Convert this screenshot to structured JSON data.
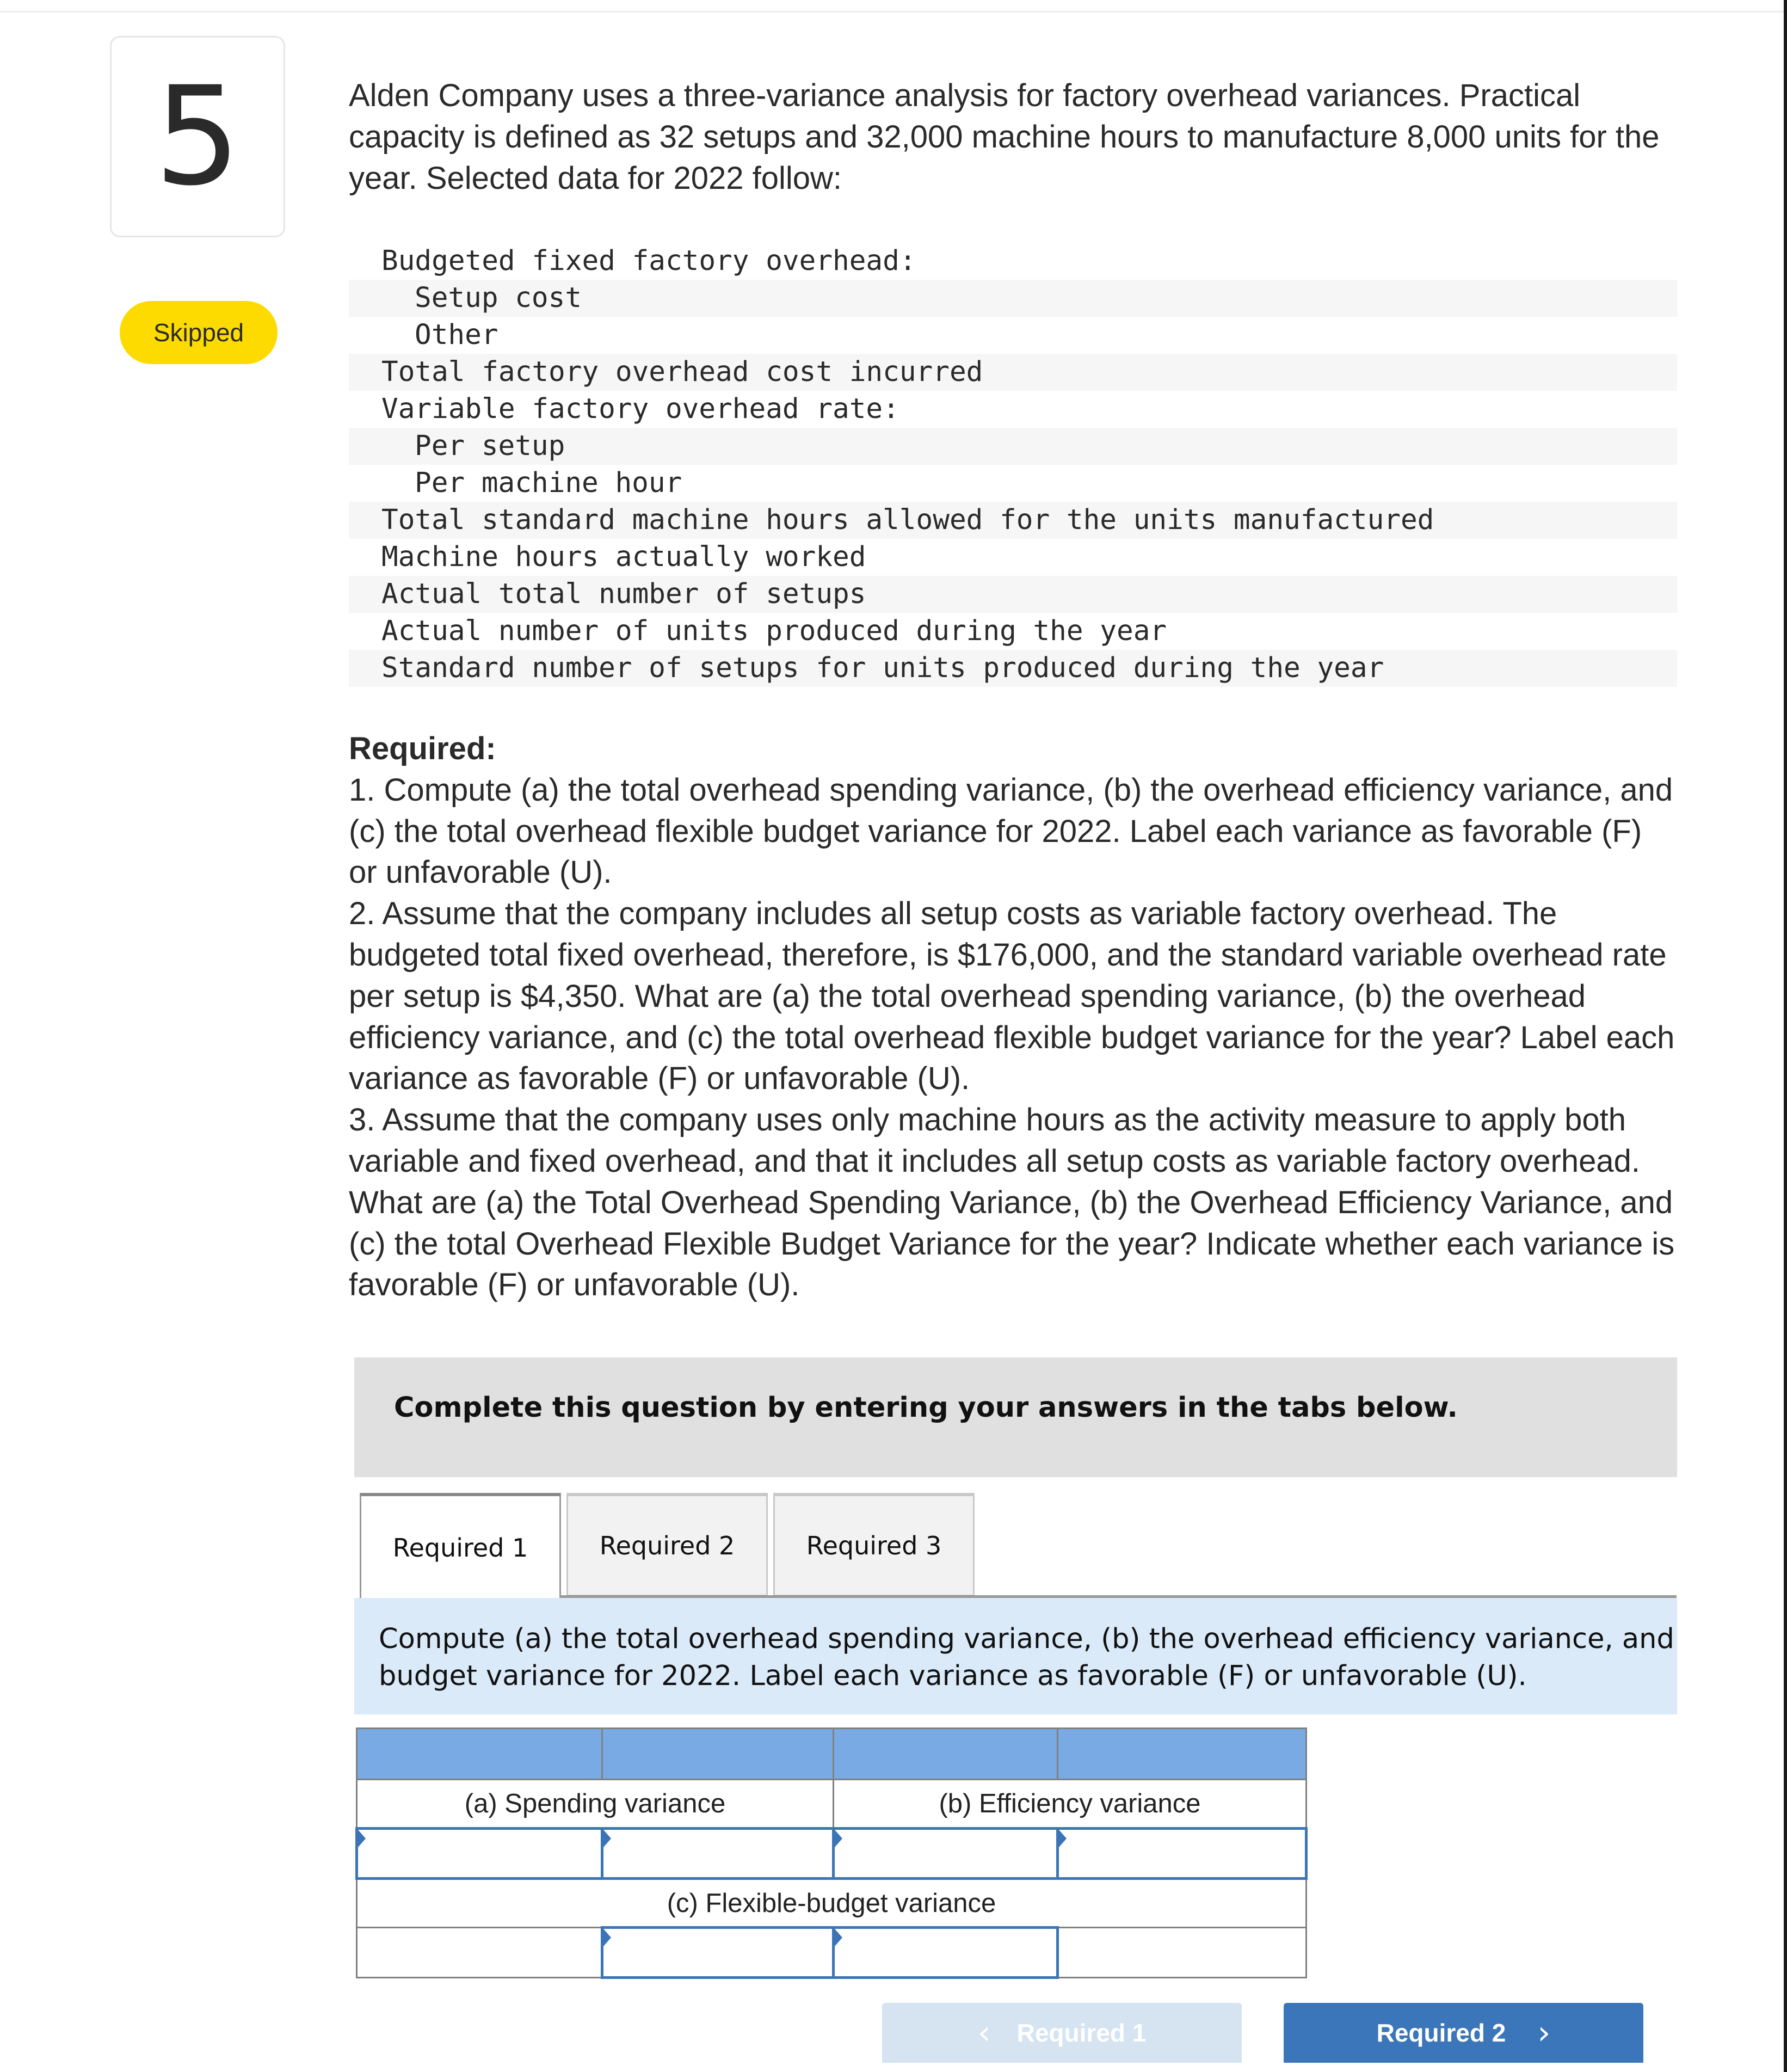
{
  "question": {
    "number": "5",
    "status_badge": "Skipped",
    "intro": "Alden Company uses a three-variance analysis for factory overhead variances. Practical capacity is defined as 32 setups and 32,000 machine hours to manufacture 8,000 units for the year. Selected data for 2022 follow:"
  },
  "data_table": {
    "rows": [
      {
        "label": "Budgeted fixed factory overhead:",
        "indent": false,
        "shaded": false
      },
      {
        "label": "Setup cost",
        "indent": true,
        "shaded": true
      },
      {
        "label": "Other",
        "indent": true,
        "shaded": false
      },
      {
        "label": "Total factory overhead cost incurred",
        "indent": false,
        "shaded": true
      },
      {
        "label": "Variable factory overhead rate:",
        "indent": false,
        "shaded": false
      },
      {
        "label": "Per setup",
        "indent": true,
        "shaded": true
      },
      {
        "label": "Per machine hour",
        "indent": true,
        "shaded": false
      },
      {
        "label": "Total standard machine hours allowed for the units manufactured",
        "indent": false,
        "shaded": true
      },
      {
        "label": "Machine hours actually worked",
        "indent": false,
        "shaded": false
      },
      {
        "label": "Actual total number of setups",
        "indent": false,
        "shaded": true
      },
      {
        "label": "Actual number of units produced during the year",
        "indent": false,
        "shaded": false
      },
      {
        "label": "Standard number of setups for units produced during the year",
        "indent": false,
        "shaded": true
      }
    ]
  },
  "required": {
    "heading": "Required:",
    "items": [
      "1. Compute (a) the total overhead spending variance, (b) the overhead efficiency variance, and (c) the total overhead flexible budget variance for 2022. Label each variance as favorable (F) or unfavorable (U).",
      "2. Assume that the company includes all setup costs as variable factory overhead. The budgeted total fixed overhead, therefore, is $176,000, and the standard variable overhead rate per setup is $4,350. What are (a) the total overhead spending variance, (b) the overhead efficiency variance, and (c) the total overhead flexible budget variance for the year? Label each variance as favorable (F) or unfavorable (U).",
      "3. Assume that the company uses only machine hours as the activity measure to apply both variable and fixed overhead, and that it includes all setup costs as variable factory overhead. What are (a) the Total Overhead Spending Variance, (b) the Overhead Efficiency Variance, and (c) the total Overhead Flexible Budget Variance for the year? Indicate whether each variance is favorable (F) or unfavorable (U)."
    ]
  },
  "instructions": "Complete this question by entering your answers in the tabs below.",
  "tabs": [
    {
      "label": "Required 1",
      "active": true
    },
    {
      "label": "Required 2",
      "active": false
    },
    {
      "label": "Required 3",
      "active": false
    }
  ],
  "tab_instruction": {
    "line1": "Compute (a) the total overhead spending variance, (b) the overhead efficiency variance, and (c) the total overhead flexible",
    "line2": "budget variance for 2022. Label each variance as favorable (F) or unfavorable (U)."
  },
  "answer_grid": {
    "spending_label": "(a) Spending variance",
    "efficiency_label": "(b) Efficiency variance",
    "flexible_label": "(c) Flexible-budget variance",
    "spending_amount": "",
    "spending_fu": "",
    "efficiency_amount": "",
    "efficiency_fu": "",
    "flexible_amount": "",
    "flexible_fu": ""
  },
  "navigation": {
    "prev_label": "Required 1",
    "next_label": "Required 2",
    "prev_icon": "chevron-left-icon",
    "next_icon": "chevron-right-icon"
  },
  "colors": {
    "badge": "#fedb00",
    "grid_header": "#79aae3",
    "input_border": "#3b75b8",
    "next_button": "#3a76b9",
    "prev_button_disabled": "#d6e3f1",
    "tab_instruction_bg": "#daeaf8"
  }
}
